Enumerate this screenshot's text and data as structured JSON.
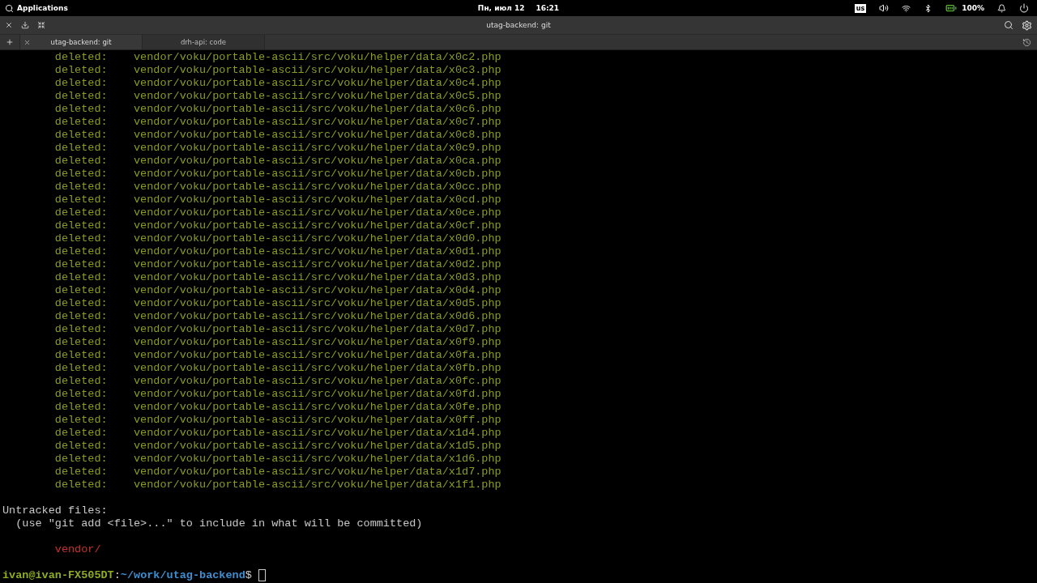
{
  "top_panel": {
    "applications": "Applications",
    "date": "Пн, июл 12",
    "time": "16:21",
    "keyboard_layout": "us",
    "battery": "100%"
  },
  "window": {
    "title": "utag-backend: git"
  },
  "tabs": [
    {
      "label": "utag-backend: git",
      "selected": true
    },
    {
      "label": "drh-api: code",
      "selected": false
    }
  ],
  "terminal": {
    "lines": [
      {
        "kind": "change",
        "status": "deleted:",
        "path": "vendor/voku/portable-ascii/src/voku/helper/data/x0c2.php"
      },
      {
        "kind": "change",
        "status": "deleted:",
        "path": "vendor/voku/portable-ascii/src/voku/helper/data/x0c3.php"
      },
      {
        "kind": "change",
        "status": "deleted:",
        "path": "vendor/voku/portable-ascii/src/voku/helper/data/x0c4.php"
      },
      {
        "kind": "change",
        "status": "deleted:",
        "path": "vendor/voku/portable-ascii/src/voku/helper/data/x0c5.php"
      },
      {
        "kind": "change",
        "status": "deleted:",
        "path": "vendor/voku/portable-ascii/src/voku/helper/data/x0c6.php"
      },
      {
        "kind": "change",
        "status": "deleted:",
        "path": "vendor/voku/portable-ascii/src/voku/helper/data/x0c7.php"
      },
      {
        "kind": "change",
        "status": "deleted:",
        "path": "vendor/voku/portable-ascii/src/voku/helper/data/x0c8.php"
      },
      {
        "kind": "change",
        "status": "deleted:",
        "path": "vendor/voku/portable-ascii/src/voku/helper/data/x0c9.php"
      },
      {
        "kind": "change",
        "status": "deleted:",
        "path": "vendor/voku/portable-ascii/src/voku/helper/data/x0ca.php"
      },
      {
        "kind": "change",
        "status": "deleted:",
        "path": "vendor/voku/portable-ascii/src/voku/helper/data/x0cb.php"
      },
      {
        "kind": "change",
        "status": "deleted:",
        "path": "vendor/voku/portable-ascii/src/voku/helper/data/x0cc.php"
      },
      {
        "kind": "change",
        "status": "deleted:",
        "path": "vendor/voku/portable-ascii/src/voku/helper/data/x0cd.php"
      },
      {
        "kind": "change",
        "status": "deleted:",
        "path": "vendor/voku/portable-ascii/src/voku/helper/data/x0ce.php"
      },
      {
        "kind": "change",
        "status": "deleted:",
        "path": "vendor/voku/portable-ascii/src/voku/helper/data/x0cf.php"
      },
      {
        "kind": "change",
        "status": "deleted:",
        "path": "vendor/voku/portable-ascii/src/voku/helper/data/x0d0.php"
      },
      {
        "kind": "change",
        "status": "deleted:",
        "path": "vendor/voku/portable-ascii/src/voku/helper/data/x0d1.php"
      },
      {
        "kind": "change",
        "status": "deleted:",
        "path": "vendor/voku/portable-ascii/src/voku/helper/data/x0d2.php"
      },
      {
        "kind": "change",
        "status": "deleted:",
        "path": "vendor/voku/portable-ascii/src/voku/helper/data/x0d3.php"
      },
      {
        "kind": "change",
        "status": "deleted:",
        "path": "vendor/voku/portable-ascii/src/voku/helper/data/x0d4.php"
      },
      {
        "kind": "change",
        "status": "deleted:",
        "path": "vendor/voku/portable-ascii/src/voku/helper/data/x0d5.php"
      },
      {
        "kind": "change",
        "status": "deleted:",
        "path": "vendor/voku/portable-ascii/src/voku/helper/data/x0d6.php"
      },
      {
        "kind": "change",
        "status": "deleted:",
        "path": "vendor/voku/portable-ascii/src/voku/helper/data/x0d7.php"
      },
      {
        "kind": "change",
        "status": "deleted:",
        "path": "vendor/voku/portable-ascii/src/voku/helper/data/x0f9.php"
      },
      {
        "kind": "change",
        "status": "deleted:",
        "path": "vendor/voku/portable-ascii/src/voku/helper/data/x0fa.php"
      },
      {
        "kind": "change",
        "status": "deleted:",
        "path": "vendor/voku/portable-ascii/src/voku/helper/data/x0fb.php"
      },
      {
        "kind": "change",
        "status": "deleted:",
        "path": "vendor/voku/portable-ascii/src/voku/helper/data/x0fc.php"
      },
      {
        "kind": "change",
        "status": "deleted:",
        "path": "vendor/voku/portable-ascii/src/voku/helper/data/x0fd.php"
      },
      {
        "kind": "change",
        "status": "deleted:",
        "path": "vendor/voku/portable-ascii/src/voku/helper/data/x0fe.php"
      },
      {
        "kind": "change",
        "status": "deleted:",
        "path": "vendor/voku/portable-ascii/src/voku/helper/data/x0ff.php"
      },
      {
        "kind": "change",
        "status": "deleted:",
        "path": "vendor/voku/portable-ascii/src/voku/helper/data/x1d4.php"
      },
      {
        "kind": "change",
        "status": "deleted:",
        "path": "vendor/voku/portable-ascii/src/voku/helper/data/x1d5.php"
      },
      {
        "kind": "change",
        "status": "deleted:",
        "path": "vendor/voku/portable-ascii/src/voku/helper/data/x1d6.php"
      },
      {
        "kind": "change",
        "status": "deleted:",
        "path": "vendor/voku/portable-ascii/src/voku/helper/data/x1d7.php"
      },
      {
        "kind": "change",
        "status": "deleted:",
        "path": "vendor/voku/portable-ascii/src/voku/helper/data/x1f1.php"
      },
      {
        "kind": "blank"
      },
      {
        "kind": "plain",
        "text": "Untracked files:"
      },
      {
        "kind": "hint",
        "text": "(use \"git add <file>...\" to include in what will be committed)"
      },
      {
        "kind": "blank"
      },
      {
        "kind": "untracked",
        "text": "vendor/"
      },
      {
        "kind": "blank"
      }
    ],
    "prompt": {
      "user_host": "ivan@ivan-FX505DT",
      "separator": ":",
      "cwd": "~/work/utag-backend",
      "symbol": "$"
    }
  }
}
